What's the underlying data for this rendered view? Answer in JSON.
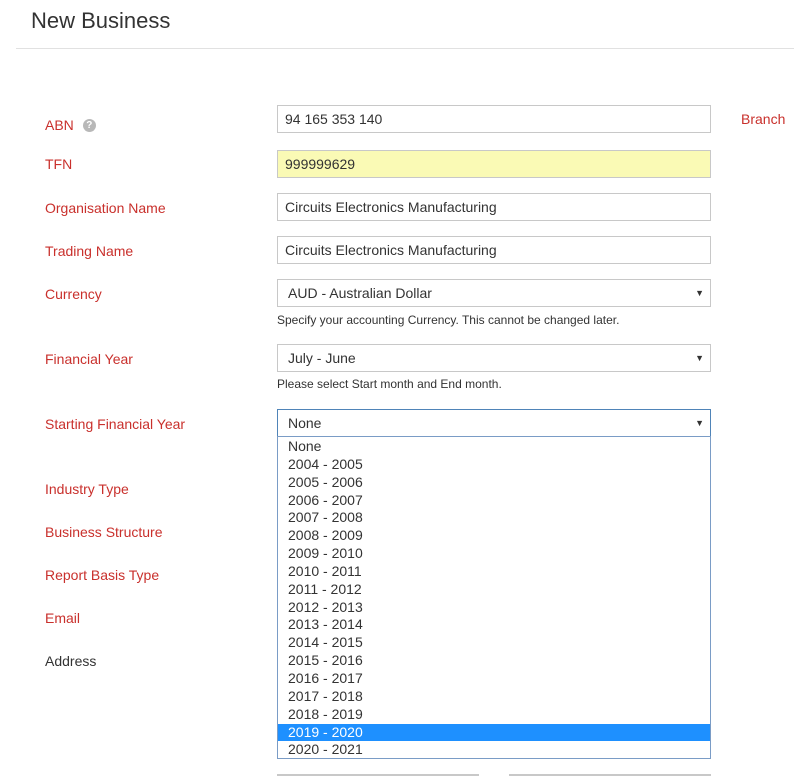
{
  "page": {
    "title": "New Business"
  },
  "form": {
    "abn": {
      "label": "ABN",
      "help_icon": "?",
      "value": "94 165 353 140"
    },
    "branch_link": "Branch",
    "tfn": {
      "label": "TFN",
      "value": "999999629"
    },
    "organisation_name": {
      "label": "Organisation Name",
      "value": "Circuits Electronics Manufacturing"
    },
    "trading_name": {
      "label": "Trading Name",
      "value": "Circuits Electronics Manufacturing"
    },
    "currency": {
      "label": "Currency",
      "value": "AUD - Australian Dollar",
      "help": "Specify your accounting Currency. This cannot be changed later."
    },
    "financial_year": {
      "label": "Financial Year",
      "value": "July - June",
      "help": "Please select Start month and End month."
    },
    "starting_financial_year": {
      "label": "Starting Financial Year",
      "value": "None",
      "options": [
        "None",
        "2004 - 2005",
        "2005 - 2006",
        "2006 - 2007",
        "2007 - 2008",
        "2008 - 2009",
        "2009 - 2010",
        "2010 - 2011",
        "2011 - 2012",
        "2012 - 2013",
        "2013 - 2014",
        "2014 - 2015",
        "2015 - 2016",
        "2016 - 2017",
        "2017 - 2018",
        "2018 - 2019",
        "2019 - 2020",
        "2020 - 2021"
      ],
      "highlighted_option": "2019 - 2020"
    },
    "industry_type": {
      "label": "Industry Type"
    },
    "business_structure": {
      "label": "Business Structure"
    },
    "report_basis_type": {
      "label": "Report Basis Type"
    },
    "email": {
      "label": "Email"
    },
    "address": {
      "label": "Address"
    }
  },
  "colors": {
    "label_red": "#c9302c",
    "highlight_blue": "#1e90ff",
    "tfn_yellow": "#fafab5"
  }
}
